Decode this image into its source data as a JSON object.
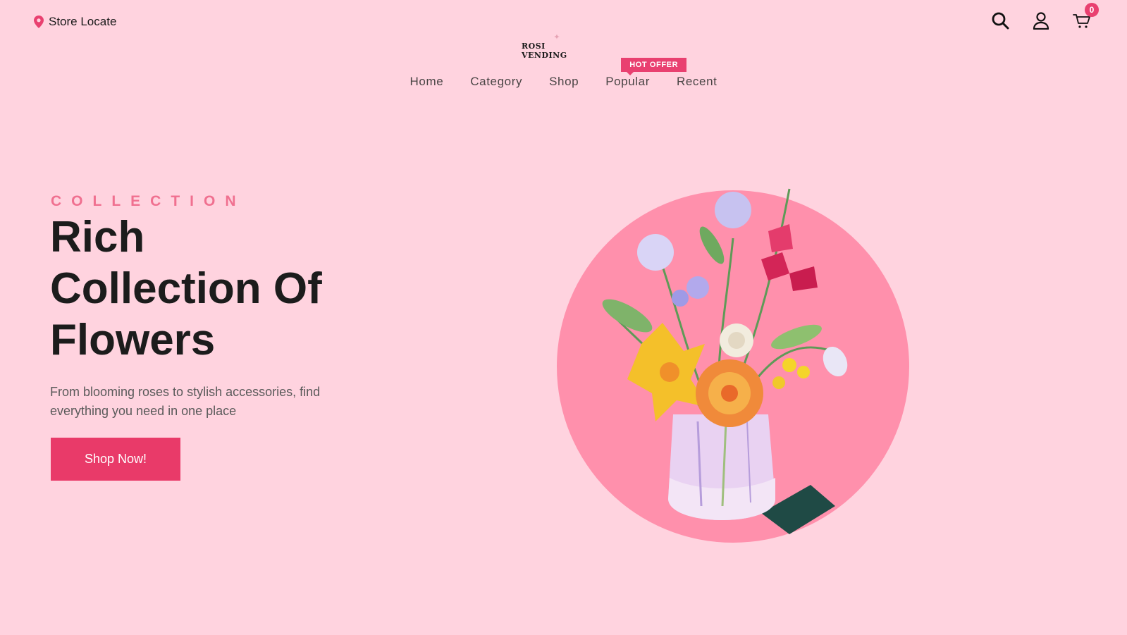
{
  "header": {
    "store_locate": "Store Locate",
    "logo_text": "ROSI VENDING",
    "cart_count": "0",
    "icons": [
      "location-pin-icon",
      "search-icon",
      "user-icon",
      "cart-icon"
    ]
  },
  "nav": {
    "items": [
      {
        "label": "Home"
      },
      {
        "label": "Category"
      },
      {
        "label": "Shop"
      },
      {
        "label": "Popular",
        "badge": "HOT OFFER"
      },
      {
        "label": "Recent"
      }
    ]
  },
  "hero": {
    "kicker": "COLLECTION",
    "headline_line1": "Rich",
    "headline_line2": "Collection Of",
    "headline_line3": "Flowers",
    "subtext": "From blooming roses to stylish accessories, find everything you need in one place",
    "cta_label": "Shop Now!"
  },
  "colors": {
    "background": "#ffd3df",
    "accent": "#e93a69",
    "circle": "#ff90ac",
    "kicker": "#f07090",
    "text_dark": "#1c1c1c"
  }
}
